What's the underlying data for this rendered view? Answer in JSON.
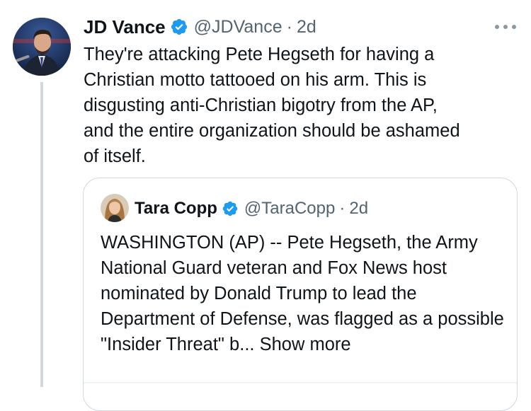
{
  "tweet": {
    "author_name": "JD Vance",
    "author_handle": "@JDVance",
    "separator": "·",
    "timestamp": "2d",
    "avatar_icon": "profile-photo-icon",
    "verified_icon": "verified-badge-icon",
    "more_icon": "more-options-icon",
    "text": "They're attacking Pete Hegseth for having a\nChristian motto tattooed on his arm. This is\ndisgusting anti-Christian bigotry from the AP,\nand the entire organization should be ashamed\nof itself."
  },
  "quoted_tweet": {
    "author_name": "Tara Copp",
    "author_handle": "@TaraCopp",
    "separator": "·",
    "timestamp": "2d",
    "avatar_icon": "profile-photo-icon",
    "verified_icon": "verified-badge-icon",
    "text": "WASHINGTON (AP) -- Pete Hegseth, the Army National Guard veteran and Fox News host nominated by Donald Trump to lead the Department of Defense, was flagged as a possible \"Insider Threat\" b...",
    "show_more_label": "Show more"
  },
  "colors": {
    "text_primary": "#0f1419",
    "text_secondary": "#536471",
    "verified_blue": "#1d9bf0",
    "border": "#cfd9de"
  }
}
